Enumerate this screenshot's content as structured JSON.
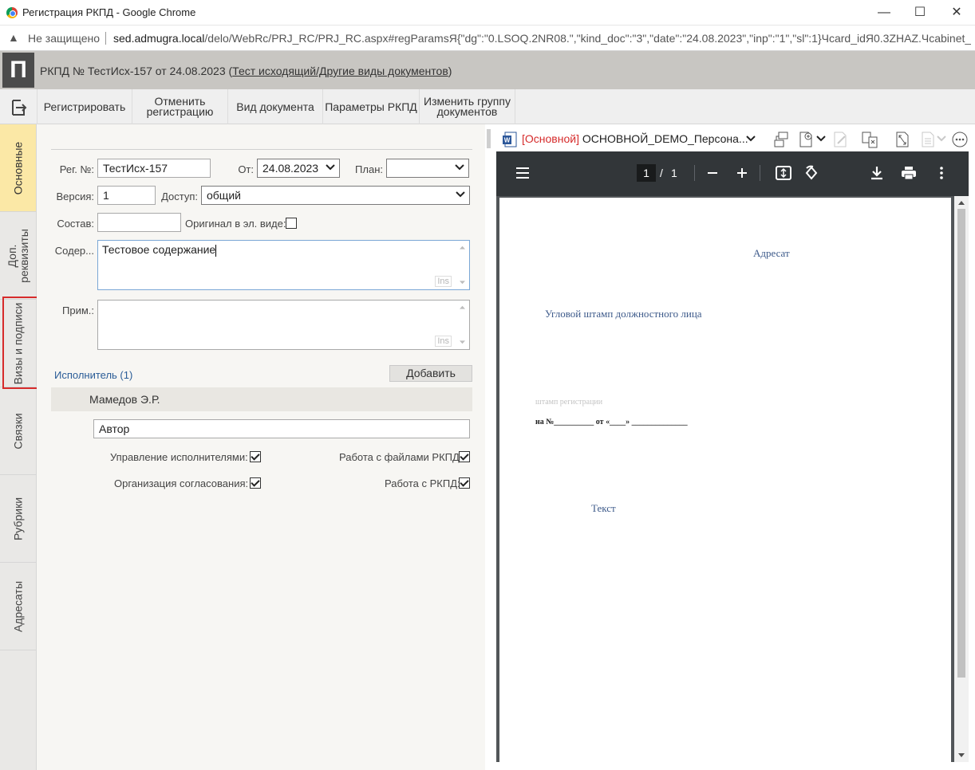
{
  "window": {
    "title": "Регистрация РКПД - Google Chrome",
    "minimize": "—",
    "maximize": "☐",
    "close": "✕"
  },
  "address": {
    "insecure_label": "Не защищено",
    "url_host": "sed.admugra.local",
    "url_rest": "/delo/WebRc/PRJ_RC/PRJ_RC.aspx#regParamsЯ{\"dg\":\"0.LSOQ.2NR08.\",\"kind_doc\":\"3\",\"date\":\"24.08.2023\",\"inp\":\"1\",\"sl\":1}Чcard_idЯ0.3ZHAZ.Чcabinet_idЯ..."
  },
  "header": {
    "logo": "П",
    "doc_prefix": "РКПД №  ТестИсх-157 от 24.08.2023 (",
    "doc_link": "Тест исходящий/Другие виды документов",
    "doc_suffix": ")"
  },
  "toolbar": {
    "register": "Регистрировать",
    "cancel_line1": "Отменить",
    "cancel_line2": "регистрацию",
    "doc_type": "Вид документа",
    "params": "Параметры РКПД",
    "change_group_line1": "Изменить группу",
    "change_group_line2": "документов"
  },
  "tabs": {
    "main": "Основные",
    "extra_line1": "Доп.",
    "extra_line2": "реквизиты",
    "visas": "Визы и подписи",
    "links": "Связки",
    "rubrics": "Рубрики",
    "addressees": "Адресаты"
  },
  "form": {
    "reg_no_label": "Рег. №:",
    "reg_no_value": "ТестИсх-157",
    "date_label": "От:",
    "date_value": "24.08.2023",
    "plan_label": "План:",
    "plan_value": "",
    "version_label": "Версия:",
    "version_value": "1",
    "access_label": "Доступ:",
    "access_value": "общий",
    "composition_label": "Состав:",
    "composition_value": "",
    "original_label": "Оригинал в эл. виде:",
    "original_checked": false,
    "content_label": "Содер...",
    "content_value": "Тестовое содержание",
    "content_ins": "Ins",
    "note_label": "Прим.:",
    "note_value": "",
    "note_ins": "Ins",
    "executor_link": "Исполнитель (1)",
    "add_button": "Добавить",
    "executor_name": "Мамедов Э.Р.",
    "role_value": "Автор",
    "perm_manage_exec": "Управление исполнителями:",
    "perm_files": "Работа с файлами РКПД:",
    "perm_approval": "Организация согласования:",
    "perm_rkpd": "Работа с РКПД:"
  },
  "preview": {
    "file_tag": "[Основной]",
    "file_name": "ОСНОВНОЙ_DEMO_Персона...",
    "page_current": "1",
    "page_sep": "/",
    "page_total": "1",
    "pdf": {
      "addressee": "Адресат",
      "corner_stamp": "Угловой штамп должностного лица",
      "reg_stamp": "штамп регистрации",
      "reply_line": "на №__________ от «____» ______________",
      "text": "Текст"
    }
  },
  "colors": {
    "accent_tab": "#fbe8a6",
    "highlight": "#d62b2b",
    "link": "#2a5c97",
    "file_tag": "#d62b2b",
    "pdf_text": "#3d5a8a"
  }
}
